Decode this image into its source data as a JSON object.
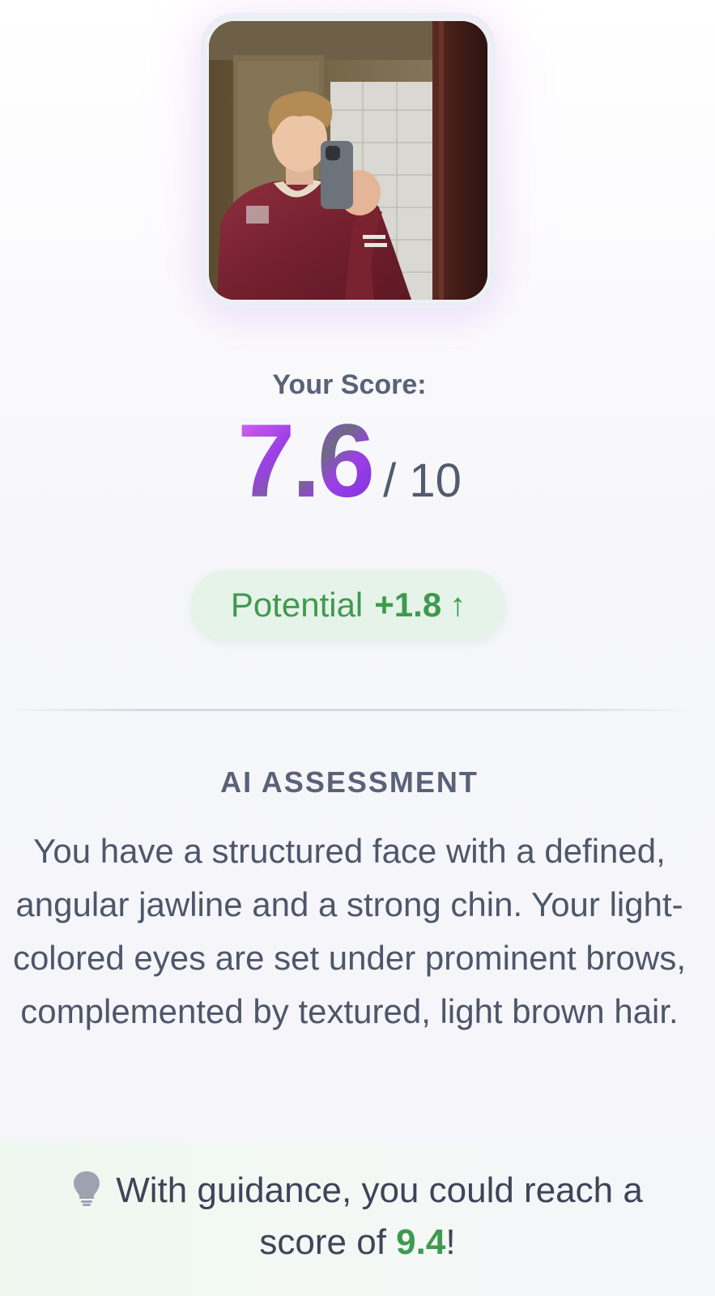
{
  "score_card": {
    "label": "Your Score:",
    "score": "7.6",
    "out_of": "/ 10"
  },
  "potential": {
    "label": "Potential",
    "delta": "+1.8",
    "arrow": "↑"
  },
  "assessment": {
    "title": "AI ASSESSMENT",
    "text": "You have a structured face with a defined, angular jawline and a strong chin. Your light-colored eyes are set under prominent brows, complemented by textured, light brown hair."
  },
  "guidance": {
    "text_before": "With guidance, you could reach a score of ",
    "goal_score": "9.4",
    "text_after": "!"
  },
  "colors": {
    "accent_purple": "#9b3fe6",
    "accent_green": "#3f9a4f",
    "text_main": "#4e566a"
  },
  "icons": {
    "guidance_icon": "lightbulb-icon",
    "potential_icon": "arrow-up-icon"
  }
}
